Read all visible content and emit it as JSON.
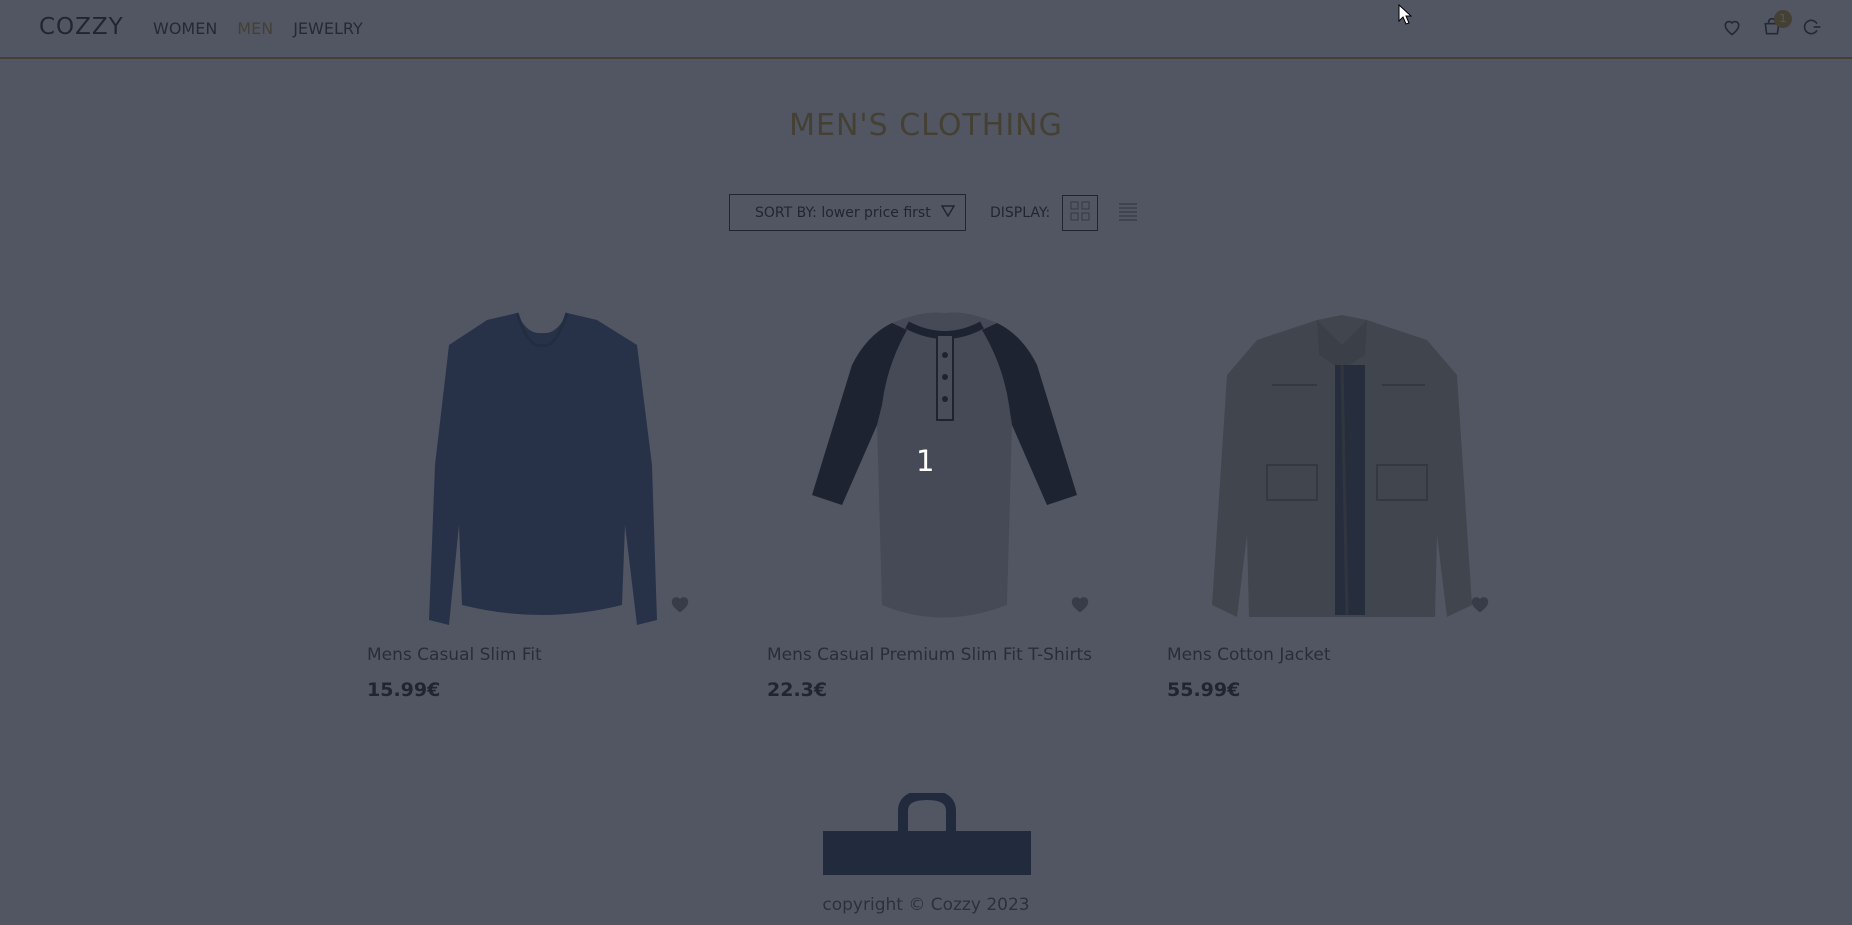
{
  "header": {
    "logo": "COZZY",
    "nav": [
      "WOMEN",
      "MEN",
      "JEWELRY"
    ],
    "active_nav": "MEN",
    "cart_count": "1",
    "icons": [
      "heart-icon",
      "cart-icon",
      "logout-icon"
    ]
  },
  "page": {
    "title": "MEN'S CLOTHING"
  },
  "controls": {
    "sort_label": "SORT BY: lower price first",
    "display_label": "DISPLAY:",
    "views": [
      "grid-view-icon",
      "list-view-icon"
    ],
    "active_view": "grid"
  },
  "products": [
    {
      "title": "Mens Casual Slim Fit",
      "price": "15.99€",
      "image": "long-sleeve-shirt"
    },
    {
      "title": "Mens Casual Premium Slim Fit T-Shirts",
      "price": "22.3€",
      "image": "raglan-henley-shirt"
    },
    {
      "title": "Mens Cotton Jacket",
      "price": "55.99€",
      "image": "cotton-jacket"
    }
  ],
  "overlay": {
    "label": "1"
  },
  "footer": {
    "copyright": "copyright © Cozzy 2023"
  },
  "colors": {
    "accent": "#c89b2e",
    "overlay": "#202636"
  }
}
